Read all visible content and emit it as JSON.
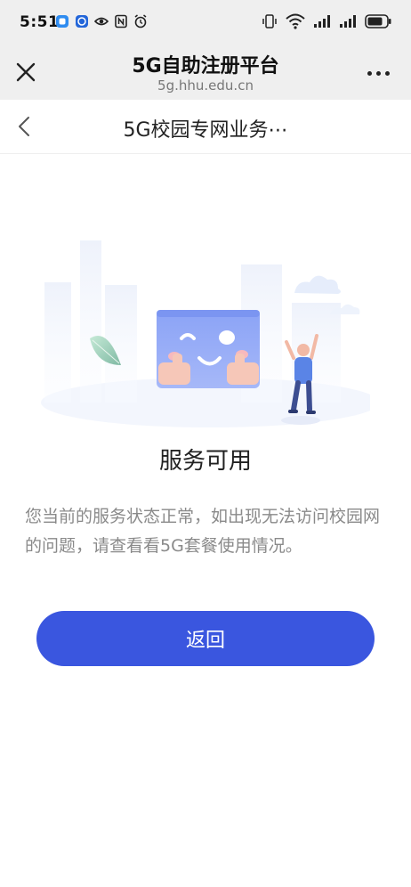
{
  "status_bar": {
    "time": "5:51",
    "left_icons": [
      "app-notification-icon",
      "app-notification-icon-2",
      "eye-icon",
      "nfc-icon",
      "alarm-icon"
    ],
    "right_icons": [
      "vibrate-icon",
      "wifi-icon",
      "signal-icon",
      "signal-icon-2",
      "battery-icon"
    ]
  },
  "browser": {
    "title": "5G自助注册平台",
    "url": "5g.hhu.edu.cn"
  },
  "header": {
    "title": "5G校园专网业务⋯"
  },
  "main": {
    "heading": "服务可用",
    "description": "您当前的服务状态正常，如出现无法访问校园网的问题，请查看看5G套餐使用情况。",
    "return_button": "返回"
  },
  "colors": {
    "accent": "#3a56df",
    "card": "#8fa6f4",
    "bar_bg": "#efefef"
  }
}
